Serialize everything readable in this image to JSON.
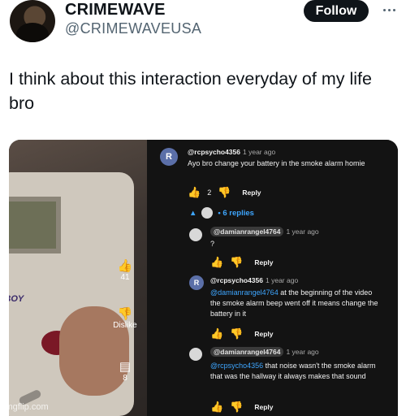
{
  "tweet": {
    "display_name": "CRIMEWAVE",
    "handle": "@CRIMEWAVEUSA",
    "follow_label": "Follow",
    "text": "I think about this interaction everyday of my life bro"
  },
  "video": {
    "logo_text": "E BOY",
    "like_count": "41",
    "dislike_label": "Dislike",
    "comment_count": "8"
  },
  "comments": [
    {
      "avatar_letter": "R",
      "user": "@rcpsycho4356",
      "time": "1 year ago",
      "text": "Ayo bro change your battery in the smoke alarm homie",
      "likes": "2",
      "reply_label": "Reply"
    },
    {
      "user": "@damianrangel4764",
      "time": "1 year ago",
      "text": "?",
      "reply_label": "Reply"
    },
    {
      "avatar_letter": "R",
      "user": "@rcpsycho4356",
      "time": "1 year ago",
      "mention": "@damianrangel4764",
      "text": " at the beginning of the video the smoke alarm beep went off it means change the battery in it",
      "reply_label": "Reply"
    },
    {
      "user": "@damianrangel4764",
      "time": "1 year ago",
      "mention": "@rcpsycho4356",
      "text": " that noise wasn't the smoke alarm that was the hallway it always makes that sound",
      "reply_label": "Reply"
    }
  ],
  "replies_toggle": "• 6 replies",
  "watermark": "imgflip.com",
  "colors": {
    "follow_bg": "#0f1419",
    "comment_panel_bg": "#131313",
    "mention_blue": "#3ea6ff",
    "handle_gray": "#536471"
  }
}
